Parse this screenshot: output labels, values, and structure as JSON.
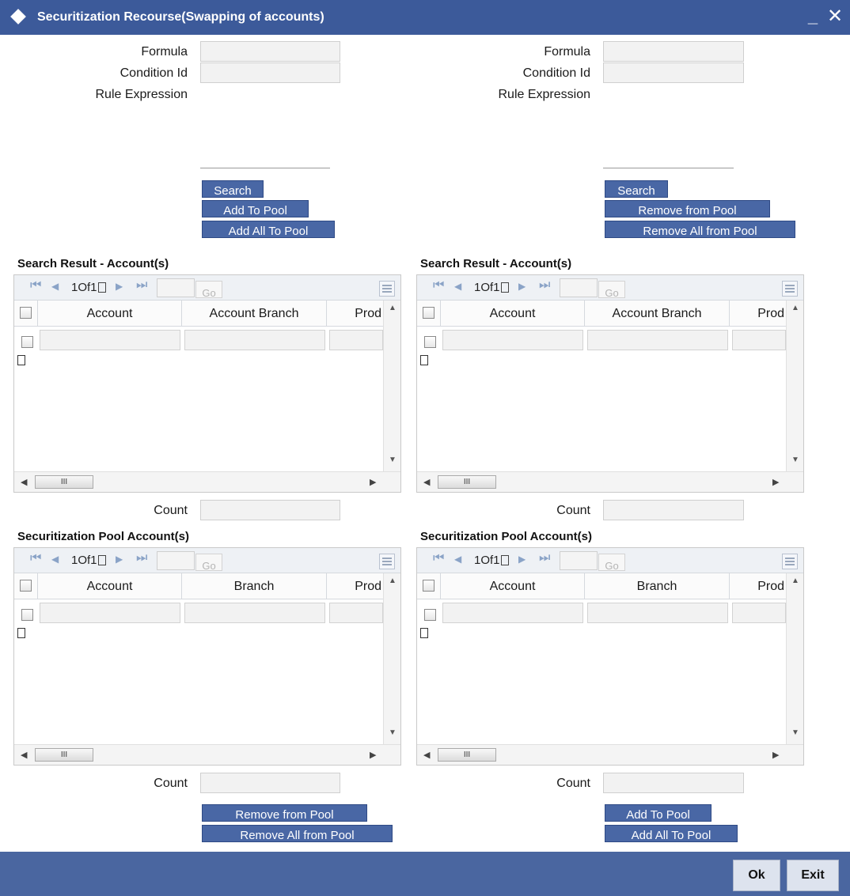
{
  "window": {
    "title": "Securitization Recourse(Swapping of accounts)",
    "minimize": "_",
    "close": "✕"
  },
  "left": {
    "formula_label": "Formula",
    "condition_label": "Condition Id",
    "rule_label": "Rule Expression",
    "formula_value": "",
    "condition_value": "",
    "search_btn": "Search",
    "action1_btn": "Add To Pool",
    "action2_btn": "Add All To Pool",
    "result_title": "Search Result - Account(s)",
    "result_grid": {
      "page_info": "1Of1",
      "go": "Go",
      "col1": "Account",
      "col2": "Account Branch",
      "col3": "Prod"
    },
    "count_label": "Count",
    "count_value": "",
    "pool_title": "Securitization Pool Account(s)",
    "pool_grid": {
      "page_info": "1Of1",
      "go": "Go",
      "col1": "Account",
      "col2": "Branch",
      "col3": "Prod"
    },
    "pool_count_label": "Count",
    "pool_count_value": "",
    "pool_btn1": "Remove from Pool",
    "pool_btn2": "Remove All from Pool"
  },
  "right": {
    "formula_label": "Formula",
    "condition_label": "Condition Id",
    "rule_label": "Rule Expression",
    "formula_value": "",
    "condition_value": "",
    "search_btn": "Search",
    "action1_btn": "Remove from Pool",
    "action2_btn": "Remove All from Pool",
    "result_title": "Search Result - Account(s)",
    "result_grid": {
      "page_info": "1Of1",
      "go": "Go",
      "col1": "Account",
      "col2": "Account Branch",
      "col3": "Prod"
    },
    "count_label": "Count",
    "count_value": "",
    "pool_title": "Securitization Pool Account(s)",
    "pool_grid": {
      "page_info": "1Of1",
      "go": "Go",
      "col1": "Account",
      "col2": "Branch",
      "col3": "Prod"
    },
    "pool_count_label": "Count",
    "pool_count_value": "",
    "pool_btn1": "Add To Pool",
    "pool_btn2": "Add All To Pool"
  },
  "scroll_thumb": "III",
  "footer": {
    "ok": "Ok",
    "exit": "Exit"
  },
  "colors": {
    "title_bar": "#3c5a9a",
    "button": "#4967a5",
    "footer": "#4a66a0"
  }
}
